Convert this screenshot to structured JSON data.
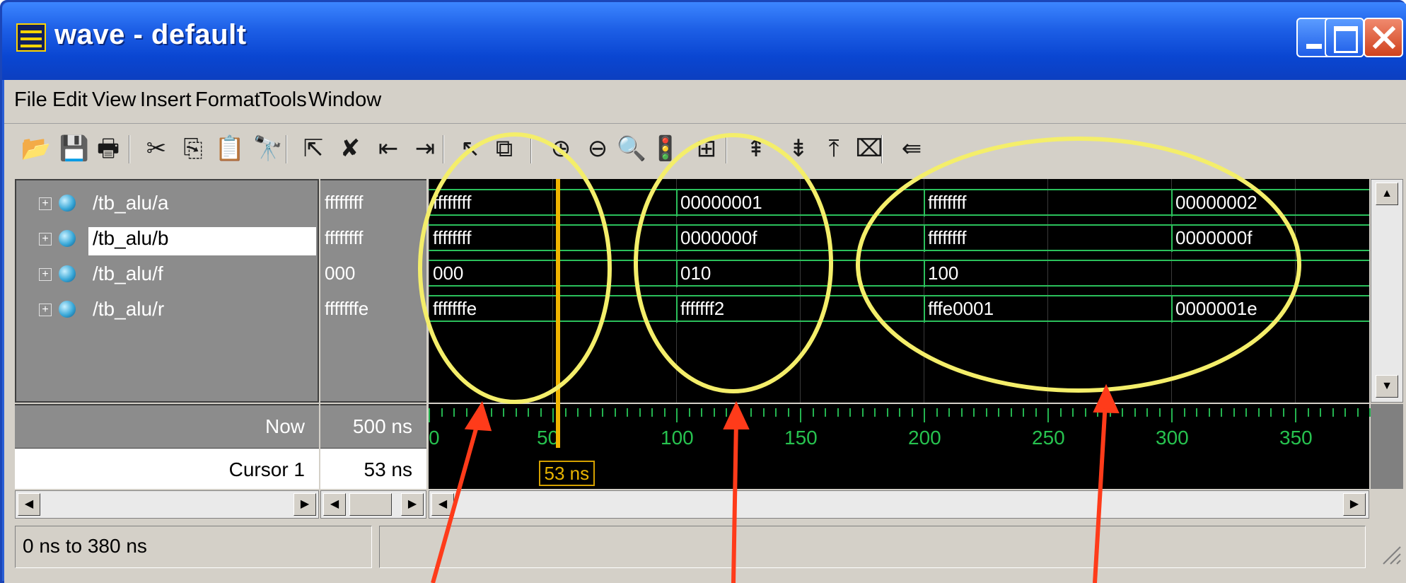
{
  "window": {
    "title": "wave - default"
  },
  "menu": [
    "File",
    "Edit",
    "View",
    "Insert",
    "Format",
    "Tools",
    "Window"
  ],
  "toolbar": {
    "icons": [
      {
        "name": "open-icon",
        "glyph": "📂"
      },
      {
        "name": "save-icon",
        "glyph": "💾"
      },
      {
        "name": "print-icon",
        "glyph": "🖶"
      },
      {
        "name": "cut-icon",
        "glyph": "✂"
      },
      {
        "name": "copy-icon",
        "glyph": "⎘"
      },
      {
        "name": "paste-icon",
        "glyph": "📋"
      },
      {
        "name": "find-icon",
        "glyph": "🔭"
      },
      {
        "name": "select-add-icon",
        "glyph": "⇱"
      },
      {
        "name": "delete-icon",
        "glyph": "✘"
      },
      {
        "name": "insert-divider-icon",
        "glyph": "⇤"
      },
      {
        "name": "insert-breakpoint-icon",
        "glyph": "⇥"
      },
      {
        "name": "select-mode-icon",
        "glyph": "↖"
      },
      {
        "name": "zoom-mode-icon",
        "glyph": "⧉"
      },
      {
        "name": "zoom-in-icon",
        "glyph": "⊕"
      },
      {
        "name": "zoom-out-icon",
        "glyph": "⊖"
      },
      {
        "name": "zoom-full-icon",
        "glyph": "🔍"
      },
      {
        "name": "zoom-cursor-icon",
        "glyph": "🚦"
      },
      {
        "name": "insert-cursor-icon",
        "glyph": "⊞"
      },
      {
        "name": "find-previous-edge-icon",
        "glyph": "⇞"
      },
      {
        "name": "find-next-edge-icon",
        "glyph": "⇟"
      },
      {
        "name": "find-first-edge-icon",
        "glyph": "⤒"
      },
      {
        "name": "delete-cursor-icon",
        "glyph": "⌧"
      },
      {
        "name": "exit-icon",
        "glyph": "⇚"
      }
    ]
  },
  "signals": [
    {
      "name": "/tb_alu/a",
      "value": "ffffffff",
      "selected": false,
      "segments": [
        {
          "t": 0,
          "v": "ffffffff"
        },
        {
          "t": 100,
          "v": "00000001"
        },
        {
          "t": 200,
          "v": "ffffffff"
        },
        {
          "t": 300,
          "v": "00000002"
        }
      ]
    },
    {
      "name": "/tb_alu/b",
      "value": "ffffffff",
      "selected": true,
      "segments": [
        {
          "t": 0,
          "v": "ffffffff"
        },
        {
          "t": 100,
          "v": "0000000f"
        },
        {
          "t": 200,
          "v": "ffffffff"
        },
        {
          "t": 300,
          "v": "0000000f"
        }
      ]
    },
    {
      "name": "/tb_alu/f",
      "value": "000",
      "selected": false,
      "segments": [
        {
          "t": 0,
          "v": "000"
        },
        {
          "t": 100,
          "v": "010"
        },
        {
          "t": 200,
          "v": "100"
        }
      ]
    },
    {
      "name": "/tb_alu/r",
      "value": "fffffffe",
      "selected": false,
      "segments": [
        {
          "t": 0,
          "v": "fffffffe"
        },
        {
          "t": 100,
          "v": "fffffff2"
        },
        {
          "t": 200,
          "v": "fffe0001"
        },
        {
          "t": 300,
          "v": "0000001e"
        }
      ]
    }
  ],
  "timeline": {
    "now_label": "Now",
    "now_value": "500 ns",
    "cursor_label": "Cursor 1",
    "cursor_value": "53 ns",
    "cursor_time": 53,
    "cursor_flag": "53 ns",
    "start": 0,
    "end": 380,
    "labels": [
      "0",
      "50",
      "100",
      "150",
      "200",
      "250",
      "300",
      "350"
    ]
  },
  "status": {
    "range": "0 ns to 380 ns"
  },
  "colors": {
    "wave": "#2bbf5b",
    "cursor": "#f0b400",
    "annotation": "#f4ee6a",
    "arrow": "#ff3b1a"
  }
}
